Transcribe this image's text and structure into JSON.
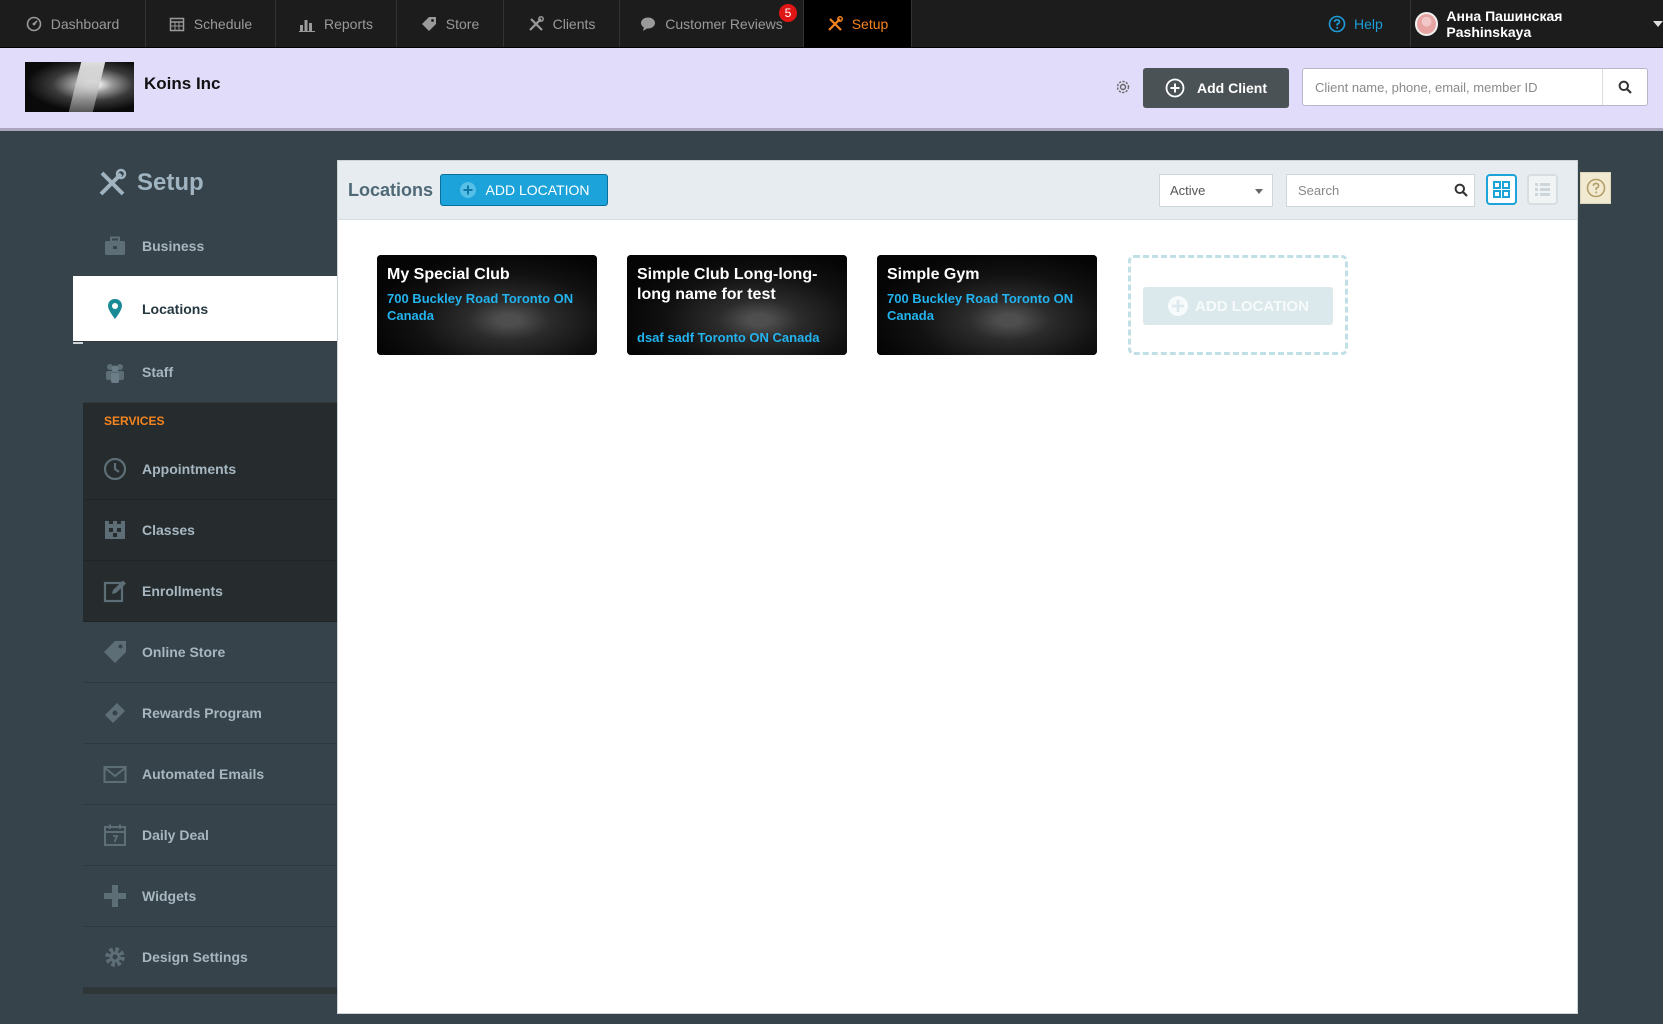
{
  "topnav": {
    "items": [
      {
        "label": "Dashboard",
        "icon": "dashboard-icon"
      },
      {
        "label": "Schedule",
        "icon": "calendar-icon"
      },
      {
        "label": "Reports",
        "icon": "bar-chart-icon"
      },
      {
        "label": "Store",
        "icon": "tag-icon"
      },
      {
        "label": "Clients",
        "icon": "tools-icon"
      },
      {
        "label": "Customer Reviews",
        "icon": "speech-bubble-icon",
        "badge": "5"
      },
      {
        "label": "Setup",
        "icon": "tools-icon",
        "active": true
      }
    ],
    "help_label": "Help",
    "user_name": "Анна Пашинская Pashinskaya"
  },
  "business": {
    "name": "Koins Inc",
    "add_client_label": "Add Client",
    "search_placeholder": "Client name, phone, email, member ID"
  },
  "sidebar": {
    "title": "Setup",
    "items": [
      {
        "label": "Business",
        "icon": "briefcase-icon"
      },
      {
        "label": "Locations",
        "icon": "map-pin-icon",
        "active": true
      },
      {
        "label": "Staff",
        "icon": "people-icon"
      }
    ],
    "services_header": "SERVICES",
    "service_items": [
      {
        "label": "Appointments",
        "icon": "clock-icon"
      },
      {
        "label": "Classes",
        "icon": "classes-icon"
      },
      {
        "label": "Enrollments",
        "icon": "edit-icon"
      }
    ],
    "other_items": [
      {
        "label": "Online Store",
        "icon": "tag-icon"
      },
      {
        "label": "Rewards Program",
        "icon": "ticket-icon"
      },
      {
        "label": "Automated Emails",
        "icon": "envelope-icon"
      },
      {
        "label": "Daily Deal",
        "icon": "calendar-icon"
      },
      {
        "label": "Widgets",
        "icon": "plus-icon"
      },
      {
        "label": "Design Settings",
        "icon": "gear-icon"
      }
    ]
  },
  "main": {
    "title": "Locations",
    "add_location_label": "ADD LOCATION",
    "status_filter": "Active",
    "search_placeholder": "Search",
    "locations": [
      {
        "name": "My Special Club",
        "address": "700 Buckley Road Toronto ON Canada"
      },
      {
        "name": "Simple Club Long-long-long name for test",
        "address": "dsaf sadf Toronto ON Canada"
      },
      {
        "name": "Simple Gym",
        "address": "700 Buckley Road Toronto ON Canada"
      }
    ],
    "add_location_card_label": "ADD LOCATION"
  },
  "colors": {
    "accent_blue": "#1ba3da",
    "accent_orange": "#f5841f",
    "header_lavender": "#e0dcf9",
    "sidebar_dark": "#37434a",
    "badge_red": "#e01515"
  }
}
